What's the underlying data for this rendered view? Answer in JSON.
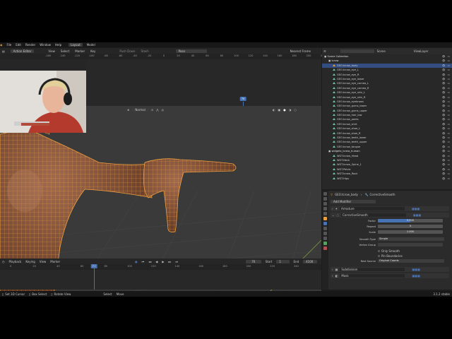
{
  "menu": [
    "File",
    "Edit",
    "Render",
    "Window",
    "Help"
  ],
  "workspaces": [
    "Layout",
    "Model"
  ],
  "dopesheet": {
    "mode": "Action Editor",
    "menus": [
      "View",
      "Select",
      "Marker",
      "Key"
    ],
    "action": "Push Down",
    "stash": "Stash",
    "action_name": "Pose",
    "filter": "Nearest Frame",
    "ticks": [
      "-160",
      "-140",
      "-120",
      "-100",
      "-80",
      "-60",
      "-40",
      "-20",
      "0",
      "20",
      "40",
      "60",
      "80",
      "100",
      "120",
      "140",
      "160",
      "180",
      "200",
      "220",
      "240"
    ],
    "current_frame": "70"
  },
  "viewport": {
    "shading": "Normal",
    "header_items": [
      "Global",
      "Scene"
    ]
  },
  "timeline": {
    "menus": [
      "Playback",
      "Keying",
      "View",
      "Marker"
    ],
    "frame": "70",
    "start_label": "Start",
    "start": "1",
    "end_label": "End",
    "end": "4100",
    "ticks": [
      "0",
      "20",
      "40",
      "60",
      "70",
      "80",
      "100",
      "120",
      "140",
      "160",
      "180",
      "200",
      "220",
      "240"
    ]
  },
  "status": [
    "Set 3D Cursor",
    "Box Select",
    "Rotate View",
    "Select",
    "Move"
  ],
  "status_right": "3.1.2 stable",
  "outliner": {
    "scene": "Scene",
    "view_layer": "ViewLayer",
    "items": [
      {
        "name": "Scene Collection",
        "level": 0,
        "type": "coll"
      },
      {
        "name": "tcrow",
        "level": 1,
        "type": "coll"
      },
      {
        "name": "GEO.tcrow_body",
        "level": 2,
        "type": "mesh",
        "sel": true
      },
      {
        "name": "GEO.tcrow_eye_L",
        "level": 2,
        "type": "mesh"
      },
      {
        "name": "GEO.tcrow_eye_R",
        "level": 2,
        "type": "mesh"
      },
      {
        "name": "GEO.tcrow_eye_lower",
        "level": 2,
        "type": "mesh"
      },
      {
        "name": "GEO.tcrow_eye_cornea_L",
        "level": 2,
        "type": "mesh"
      },
      {
        "name": "GEO.tcrow_eye_cornea_R",
        "level": 2,
        "type": "mesh"
      },
      {
        "name": "GEO.tcrow_eye_skin_L",
        "level": 2,
        "type": "mesh"
      },
      {
        "name": "GEO.tcrow_eye_skin_R",
        "level": 2,
        "type": "mesh"
      },
      {
        "name": "GEO.tcrow_eyebrows",
        "level": 2,
        "type": "mesh"
      },
      {
        "name": "GEO.tcrow_gums_lower",
        "level": 2,
        "type": "mesh"
      },
      {
        "name": "GEO.tcrow_gums_upper",
        "level": 2,
        "type": "mesh"
      },
      {
        "name": "GEO.tcrow_hair_low",
        "level": 2,
        "type": "mesh"
      },
      {
        "name": "GEO.tcrow_pants",
        "level": 2,
        "type": "mesh"
      },
      {
        "name": "GEO.tcrow_shirt",
        "level": 2,
        "type": "mesh"
      },
      {
        "name": "GEO.tcrow_shoe_L",
        "level": 2,
        "type": "mesh"
      },
      {
        "name": "GEO.tcrow_shoe_R",
        "level": 2,
        "type": "mesh"
      },
      {
        "name": "GEO.tcrow_teeth_lower",
        "level": 2,
        "type": "mesh"
      },
      {
        "name": "GEO.tcrow_teeth_upper",
        "level": 2,
        "type": "mesh"
      },
      {
        "name": "GEO.tcrow_tongue",
        "level": 2,
        "type": "mesh"
      },
      {
        "name": "widgets_tcrow_human",
        "level": 1,
        "type": "coll"
      },
      {
        "name": "WGT.tcrow_Head",
        "level": 2,
        "type": "mesh"
      },
      {
        "name": "WGT.Neck",
        "level": 2,
        "type": "mesh"
      },
      {
        "name": "WGT.tcrow_Spine_1",
        "level": 2,
        "type": "mesh"
      },
      {
        "name": "WGT.Pelvis",
        "level": 2,
        "type": "mesh"
      },
      {
        "name": "WGT.tcrow_Root",
        "level": 2,
        "type": "mesh"
      },
      {
        "name": "WGT.Hips",
        "level": 2,
        "type": "mesh"
      }
    ]
  },
  "properties": {
    "object": "GEO.tcrow_body",
    "modifier_active": "CorrectiveSmooth",
    "add_modifier": "Add Modifier",
    "modifiers": [
      {
        "name": "Armature"
      },
      {
        "name": "CorrectiveSmooth",
        "expanded": true
      },
      {
        "name": "Subdivision"
      },
      {
        "name": "Mask"
      }
    ],
    "factor_label": "Factor",
    "factor": "0.500",
    "factor_fraction": 0.5,
    "repeat_label": "Repeat",
    "repeat": "5",
    "scale_label": "Scale",
    "scale": "1.000",
    "smooth_type_label": "Smooth Type",
    "smooth_type": "Simple",
    "vertex_group_label": "Vertex Group",
    "only_smooth": "Only Smooth",
    "pin_boundaries": "Pin Boundaries",
    "rest_source_label": "Rest Source",
    "rest_source": "Original Coords"
  },
  "colors": {
    "accent": "#4772b3",
    "selection": "#e8a040",
    "background": "#3a3a3a"
  }
}
